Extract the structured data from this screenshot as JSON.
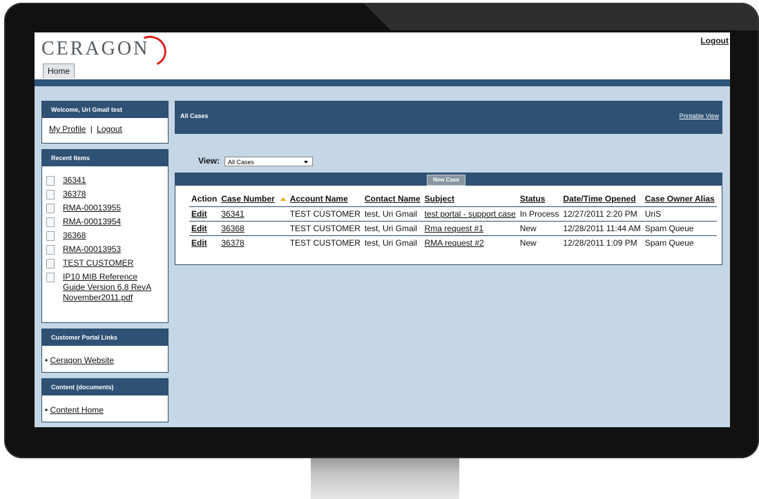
{
  "header": {
    "logo_text": "CERAGON",
    "logout": "Logout",
    "home_tab": "Home"
  },
  "welcome": {
    "title": "Welcome, Uri Gmail test",
    "my_profile": "My Profile",
    "separator": "|",
    "logout": "Logout"
  },
  "recent": {
    "title": "Recent Items",
    "items": [
      "36341",
      "36378",
      "RMA-00013955",
      "RMA-00013954",
      "36368",
      "RMA-00013953",
      "TEST CUSTOMER",
      "IP10 MIB Reference Guide Version 6.8 RevA November2011.pdf"
    ]
  },
  "portal_links": {
    "title": "Customer Portal Links",
    "items": [
      "Ceragon Website"
    ]
  },
  "content_docs": {
    "title": "Content (documents)",
    "items": [
      "Content Home"
    ]
  },
  "main": {
    "title": "All Cases",
    "printable_view": "Printable View",
    "view_label": "View:",
    "view_value": "All Cases",
    "new_case": "New Case"
  },
  "table": {
    "headers": [
      "Action",
      "Case Number",
      "Account Name",
      "Contact Name",
      "Subject",
      "Status",
      "Date/Time Opened",
      "Case Owner Alias"
    ],
    "rows": [
      [
        "Edit",
        "36341",
        "TEST CUSTOMER",
        "test, Uri Gmail",
        "test portal - support case",
        "In Process",
        "12/27/2011 2:20 PM",
        "UriS"
      ],
      [
        "Edit",
        "36368",
        "TEST CUSTOMER",
        "test, Uri Gmail",
        "Rma request #1",
        "New",
        "12/28/2011 11:44 AM",
        "Spam Queue"
      ],
      [
        "Edit",
        "36378",
        "TEST CUSTOMER",
        "test, Uri Gmail",
        "RMA request #2",
        "New",
        "12/28/2011 1:09 PM",
        "Spam Queue"
      ]
    ]
  },
  "colors": {
    "header_blue": "#2e5174",
    "screen_bg": "#c5d6e6",
    "logo_red": "#d9231d",
    "sort_arrow": "#e8a217"
  }
}
